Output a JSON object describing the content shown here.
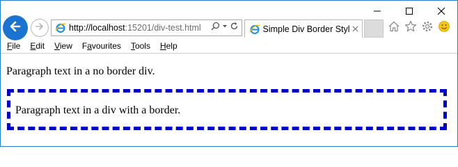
{
  "browser": {
    "url_host": "http://localhost",
    "url_rest": ":15201/div-test.html",
    "tab_title": "Simple Div Border Styl...",
    "menu": [
      {
        "accel": "F",
        "rest": "ile"
      },
      {
        "accel": "E",
        "rest": "dit"
      },
      {
        "accel": "V",
        "rest": "iew"
      },
      {
        "accel": "",
        "pre": "F",
        "accel2": "a",
        "rest": "vourites"
      },
      {
        "accel": "T",
        "rest": "ools"
      },
      {
        "accel": "H",
        "rest": "elp"
      }
    ]
  },
  "page": {
    "paragraph_no_border": "Paragraph text in a no border div.",
    "paragraph_with_border": "Paragraph text in a div with a border."
  },
  "colors": {
    "border_color": "#0000cc",
    "back_button": "#1a73d1",
    "window_frame": "#1e7fd0"
  },
  "icons": [
    "minimize-icon",
    "maximize-icon",
    "close-icon",
    "back-arrow-icon",
    "forward-arrow-icon",
    "ie-logo-icon",
    "search-icon",
    "dropdown-icon",
    "refresh-icon",
    "tab-close-icon",
    "home-icon",
    "favorites-star-icon",
    "settings-gear-icon",
    "smiley-feedback-icon"
  ]
}
